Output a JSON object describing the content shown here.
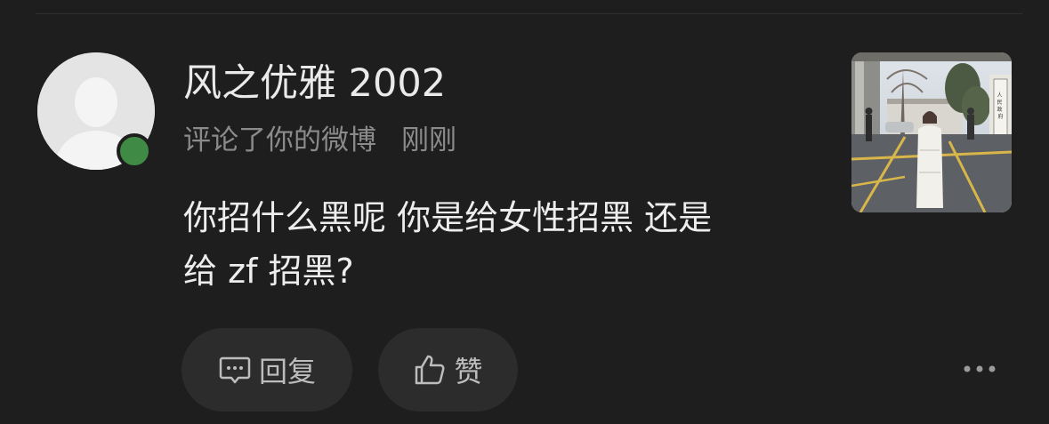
{
  "notification": {
    "username": "风之优雅 2002",
    "action": "评论了你的微博",
    "time": "刚刚",
    "comment_line1": "你招什么黑呢 你是给女性招黑 还是",
    "comment_line2": "给 zf 招黑?",
    "online_status_color": "#3f8a44"
  },
  "actions": {
    "reply_label": "回复",
    "like_label": "赞",
    "reply_icon": "comment-bubble-icon",
    "like_icon": "thumbs-up-icon",
    "more_icon": "more-dots-icon"
  },
  "thumbnail": {
    "seal_text": "人民政府"
  }
}
